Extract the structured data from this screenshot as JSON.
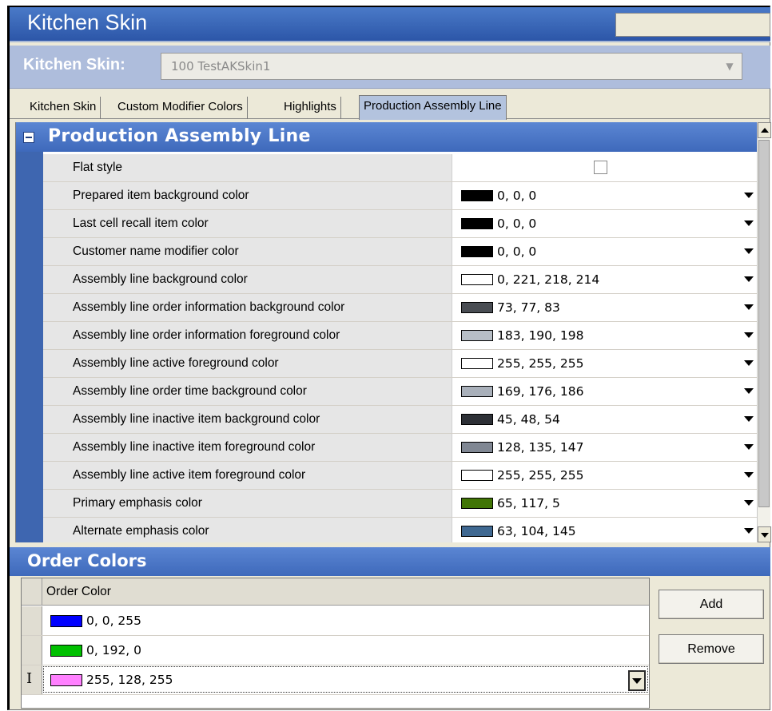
{
  "window": {
    "title": "Kitchen Skin",
    "skin_label": "Kitchen Skin:",
    "skin_value": "100 TestAKSkin1"
  },
  "tabs": [
    {
      "label": "Kitchen Skin",
      "active": false
    },
    {
      "label": "Custom Modifier Colors",
      "active": false
    },
    {
      "label": "Highlights",
      "active": false
    },
    {
      "label": "Production Assembly Line",
      "active": true
    }
  ],
  "section": {
    "title": "Production Assembly Line",
    "flat_style": {
      "label": "Flat style",
      "checked": false
    },
    "rows": [
      {
        "label": "Prepared item background color",
        "value": "0, 0, 0",
        "swatch": "#000000"
      },
      {
        "label": "Last cell recall item color",
        "value": "0, 0, 0",
        "swatch": "#000000"
      },
      {
        "label": "Customer name modifier color",
        "value": "0, 0, 0",
        "swatch": "#000000"
      },
      {
        "label": "Assembly line background color",
        "value": "0, 221, 218, 214",
        "swatch": "#ffffff"
      },
      {
        "label": "Assembly line order information background color",
        "value": "73, 77, 83",
        "swatch": "#494d53"
      },
      {
        "label": "Assembly line order information foreground color",
        "value": "183, 190, 198",
        "swatch": "#b7bec6"
      },
      {
        "label": "Assembly line active foreground color",
        "value": "255, 255, 255",
        "swatch": "#ffffff"
      },
      {
        "label": "Assembly line order time background color",
        "value": "169, 176, 186",
        "swatch": "#a9b0ba"
      },
      {
        "label": "Assembly line inactive item background color",
        "value": "45, 48, 54",
        "swatch": "#2d3036"
      },
      {
        "label": "Assembly line inactive item foreground color",
        "value": "128, 135, 147",
        "swatch": "#808793"
      },
      {
        "label": "Assembly line active item foreground color",
        "value": "255, 255, 255",
        "swatch": "#ffffff"
      },
      {
        "label": "Primary emphasis color",
        "value": "65, 117, 5",
        "swatch": "#417505"
      },
      {
        "label": "Alternate emphasis color",
        "value": "63, 104, 145",
        "swatch": "#3f6891"
      }
    ]
  },
  "order_colors": {
    "title": "Order Colors",
    "column_header": "Order Color",
    "rows": [
      {
        "value": "0, 0, 255",
        "swatch": "#0000ff"
      },
      {
        "value": "0, 192, 0",
        "swatch": "#00c000"
      },
      {
        "value": "255, 128, 255",
        "swatch": "#ff80ff",
        "editing": true,
        "row_glyph": "I"
      }
    ],
    "add_label": "Add",
    "remove_label": "Remove"
  }
}
